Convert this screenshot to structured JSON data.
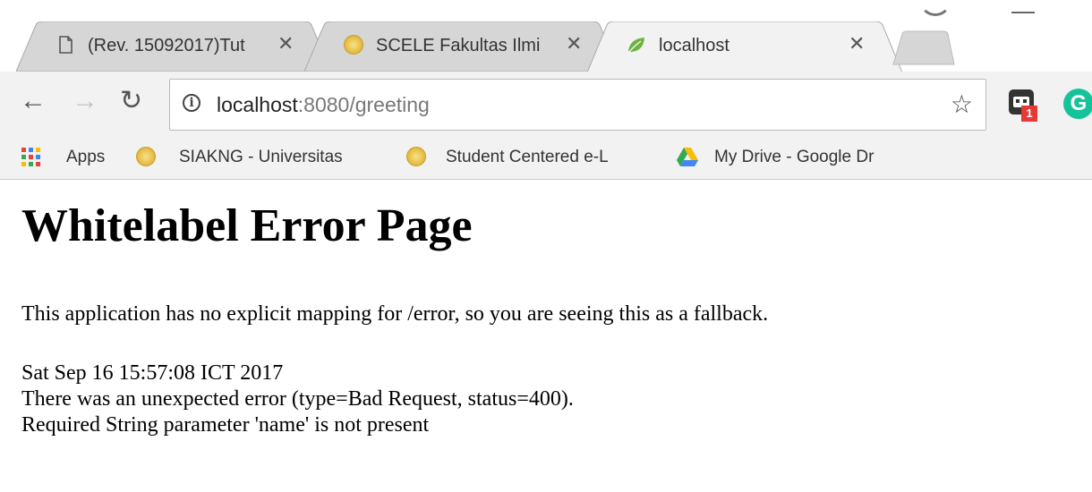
{
  "tabs": [
    {
      "title": "(Rev. 15092017)Tut",
      "favicon": "document-icon",
      "active": false
    },
    {
      "title": "SCELE Fakultas Ilmi",
      "favicon": "university-seal-icon",
      "active": false
    },
    {
      "title": "localhost",
      "favicon": "spring-leaf-icon",
      "active": true
    }
  ],
  "toolbar": {
    "url_host": "localhost",
    "url_rest": ":8080/greeting"
  },
  "extensions": {
    "badge_count": "1",
    "grammarly_letter": "G"
  },
  "bookmarks": [
    {
      "label": "Apps",
      "icon": "apps-grid-icon"
    },
    {
      "label": "SIAKNG - Universitas",
      "icon": "university-seal-icon"
    },
    {
      "label": "Student Centered e-L",
      "icon": "university-seal-icon"
    },
    {
      "label": "My Drive - Google Dr",
      "icon": "google-drive-icon"
    }
  ],
  "page": {
    "heading": "Whitelabel Error Page",
    "message": "This application has no explicit mapping for /error, so you are seeing this as a fallback.",
    "timestamp": "Sat Sep 16 15:57:08 ICT 2017",
    "error_line": "There was an unexpected error (type=Bad Request, status=400).",
    "detail": "Required String parameter 'name' is not present"
  },
  "colors": {
    "chrome_bg": "#f2f2f2",
    "active_tab": "#f2f2f2",
    "inactive_tab": "#d6d6d6",
    "grammarly": "#15c39a",
    "badge": "#e53935"
  }
}
